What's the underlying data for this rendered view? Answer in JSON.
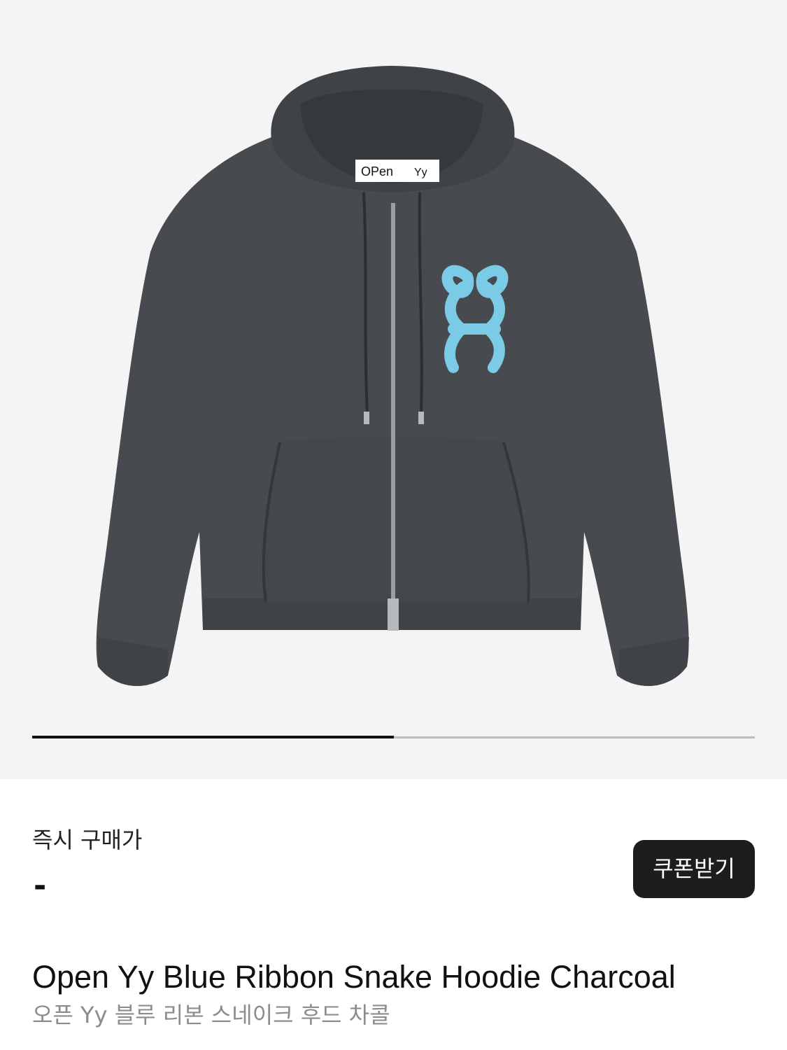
{
  "gallery": {
    "image_alt": "Open Yy Blue Ribbon Snake Hoodie Charcoal",
    "label_brand": "OPen",
    "label_logo": "Yy",
    "current_slide": 1,
    "total_slides": 2,
    "progress_fraction": 0.5,
    "colors": {
      "background": "#f4f4f4",
      "garment": "#474a4e",
      "print": "#7ccbe6",
      "indicator_active": "#111111",
      "indicator_track": "#bdbdbd"
    }
  },
  "price": {
    "label": "즉시 구매가",
    "value": "-"
  },
  "coupon_button": {
    "label": "쿠폰받기",
    "color": "#1d1d1d"
  },
  "product": {
    "name_en": "Open Yy Blue Ribbon Snake Hoodie Charcoal",
    "name_ko": "오픈 Yy 블루 리본 스네이크 후드 차콜"
  }
}
